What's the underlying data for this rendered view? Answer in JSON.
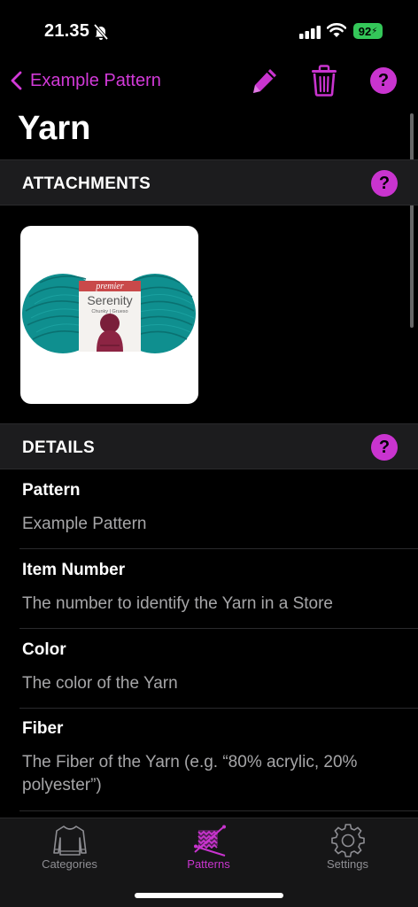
{
  "status": {
    "time": "21.35",
    "battery": "92"
  },
  "nav": {
    "back_label": "Example Pattern"
  },
  "title": "Yarn",
  "attachments": {
    "header": "ATTACHMENTS",
    "help": "?",
    "thumb_brand": "premier",
    "thumb_product": "Serenity",
    "thumb_sub": "Chunky | Grueso"
  },
  "details": {
    "header": "DETAILS",
    "help": "?",
    "rows": [
      {
        "label": "Pattern",
        "value": "Example Pattern"
      },
      {
        "label": "Item Number",
        "value": "The number to identify the Yarn in a Store"
      },
      {
        "label": "Color",
        "value": "The color of the Yarn"
      },
      {
        "label": "Fiber",
        "value": "The Fiber of the Yarn (e.g. “80% acrylic, 20% polyester”)"
      }
    ]
  },
  "nav_help": "?",
  "tabs": [
    {
      "label": "Categories",
      "icon": "sweater-icon"
    },
    {
      "label": "Patterns",
      "icon": "knitting-icon",
      "active": true
    },
    {
      "label": "Settings",
      "icon": "gear-icon"
    }
  ],
  "colors": {
    "accent": "#c934cf",
    "background": "#000000",
    "section": "#1c1c1e",
    "secondary_text": "#a6a6a8",
    "yarn": "#0f8f8f"
  }
}
